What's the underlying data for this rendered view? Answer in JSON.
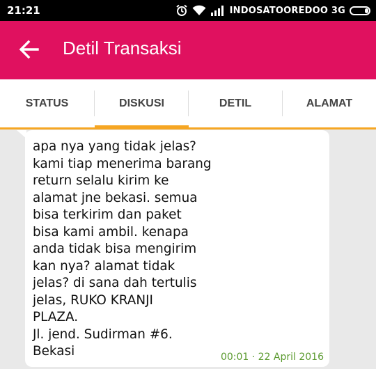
{
  "status_bar": {
    "time": "21:21",
    "carrier": "INDOSATOOREDOO 3G",
    "icons": [
      "alarm-icon",
      "wifi-icon",
      "signal-icon",
      "battery-icon"
    ]
  },
  "app_bar": {
    "title": "Detil Transaksi",
    "color": "#e0115f"
  },
  "tabs": [
    {
      "label": "STATUS"
    },
    {
      "label": "DISKUSI",
      "selected": true
    },
    {
      "label": "DETIL"
    },
    {
      "label": "ALAMAT"
    }
  ],
  "accent": "#f6a623",
  "message": {
    "text": "apa nya yang tidak jelas?\nkami tiap menerima barang\nreturn selalu kirim ke\nalamat jne bekasi. semua\nbisa terkirim dan paket\nbisa kami ambil. kenapa\nanda tidak bisa mengirim\nkan nya? alamat tidak\njelas? di sana dah tertulis\njelas, RUKO KRANJI\nPLAZA.\nJl. jend. Sudirman #6.\nBekasi",
    "timestamp": "00:01 · 22 April 2016"
  }
}
